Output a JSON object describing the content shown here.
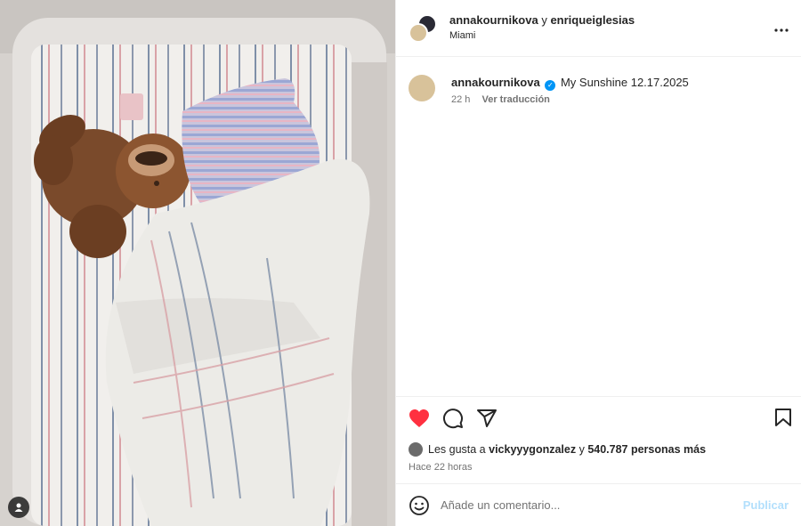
{
  "header": {
    "user1": "annakournikova",
    "joiner": "y",
    "user2": "enriqueiglesias",
    "location": "Miami",
    "more_icon": "more-horizontal-icon"
  },
  "caption": {
    "username": "annakournikova",
    "verified": "verified-badge-icon",
    "text": "My Sunshine 12.17.2025",
    "age": "22 h",
    "translate": "Ver traducción"
  },
  "actions": {
    "like_icon": "heart-filled-icon",
    "comment_icon": "comment-icon",
    "share_icon": "share-icon",
    "save_icon": "bookmark-icon",
    "like_color": "#ff3040"
  },
  "likes": {
    "prefix": "Les gusta a",
    "user": "vickyyygonzalez",
    "joiner": "y",
    "count": "540.787 personas más"
  },
  "timestamp": "Hace 22 horas",
  "comment_box": {
    "placeholder": "Añade un comentario...",
    "publish": "Publicar",
    "emoji_icon": "emoji-icon"
  },
  "media": {
    "tag_icon": "user-tag-icon"
  }
}
